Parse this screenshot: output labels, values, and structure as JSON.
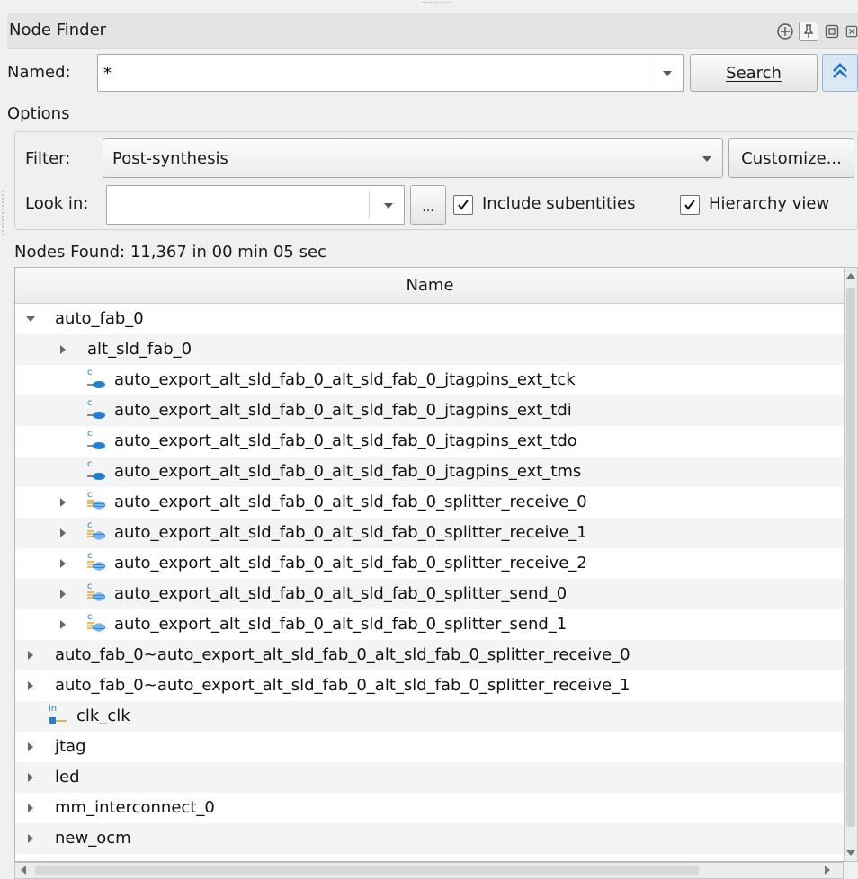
{
  "panel": {
    "title": "Node Finder",
    "controls": [
      "add-icon",
      "pin-icon",
      "float-icon",
      "close-icon"
    ]
  },
  "search": {
    "named_label": "Named:",
    "named_value": "*",
    "search_button": "Search"
  },
  "options": {
    "heading": "Options",
    "filter_label": "Filter:",
    "filter_value": "Post-synthesis",
    "customize_button": "Customize...",
    "look_in_label": "Look in:",
    "look_in_value": "",
    "browse_button": "...",
    "include_subentities_label": "Include subentities",
    "include_subentities_checked": true,
    "hierarchy_view_label": "Hierarchy view",
    "hierarchy_view_checked": true
  },
  "results": {
    "status": "Nodes Found: 11,367 in 00 min 05 sec",
    "column_name": "Name",
    "rows": [
      {
        "label": "auto_fab_0",
        "level": 0,
        "expander": "open",
        "icon": "none"
      },
      {
        "label": "alt_sld_fab_0",
        "level": 1,
        "expander": "closed",
        "icon": "none"
      },
      {
        "label": "auto_export_alt_sld_fab_0_alt_sld_fab_0_jtagpins_ext_tck",
        "level": 1,
        "expander": "none",
        "icon": "combinational-pin-icon"
      },
      {
        "label": "auto_export_alt_sld_fab_0_alt_sld_fab_0_jtagpins_ext_tdi",
        "level": 1,
        "expander": "none",
        "icon": "combinational-pin-icon"
      },
      {
        "label": "auto_export_alt_sld_fab_0_alt_sld_fab_0_jtagpins_ext_tdo",
        "level": 1,
        "expander": "none",
        "icon": "combinational-pin-icon"
      },
      {
        "label": "auto_export_alt_sld_fab_0_alt_sld_fab_0_jtagpins_ext_tms",
        "level": 1,
        "expander": "none",
        "icon": "combinational-pin-icon"
      },
      {
        "label": "auto_export_alt_sld_fab_0_alt_sld_fab_0_splitter_receive_0",
        "level": 1,
        "expander": "closed",
        "icon": "combinational-bus-icon"
      },
      {
        "label": "auto_export_alt_sld_fab_0_alt_sld_fab_0_splitter_receive_1",
        "level": 1,
        "expander": "closed",
        "icon": "combinational-bus-icon"
      },
      {
        "label": "auto_export_alt_sld_fab_0_alt_sld_fab_0_splitter_receive_2",
        "level": 1,
        "expander": "closed",
        "icon": "combinational-bus-icon"
      },
      {
        "label": "auto_export_alt_sld_fab_0_alt_sld_fab_0_splitter_send_0",
        "level": 1,
        "expander": "closed",
        "icon": "combinational-bus-icon"
      },
      {
        "label": "auto_export_alt_sld_fab_0_alt_sld_fab_0_splitter_send_1",
        "level": 1,
        "expander": "closed",
        "icon": "combinational-bus-icon"
      },
      {
        "label": "auto_fab_0~auto_export_alt_sld_fab_0_alt_sld_fab_0_splitter_receive_0",
        "level": 0,
        "expander": "closed",
        "icon": "none"
      },
      {
        "label": "auto_fab_0~auto_export_alt_sld_fab_0_alt_sld_fab_0_splitter_receive_1",
        "level": 0,
        "expander": "closed",
        "icon": "none"
      },
      {
        "label": "clk_clk",
        "level": 0,
        "expander": "none",
        "icon": "input-pin-icon"
      },
      {
        "label": "jtag",
        "level": 0,
        "expander": "closed",
        "icon": "none"
      },
      {
        "label": "led",
        "level": 0,
        "expander": "closed",
        "icon": "none"
      },
      {
        "label": "mm_interconnect_0",
        "level": 0,
        "expander": "closed",
        "icon": "none"
      },
      {
        "label": "new_ocm",
        "level": 0,
        "expander": "closed",
        "icon": "none"
      }
    ]
  },
  "colors": {
    "pin_blue": "#1f7fd4",
    "bus_blue": "#2a8be0",
    "bus_orange": "#f0a020",
    "collapse_arrow": "#1c72c8"
  }
}
